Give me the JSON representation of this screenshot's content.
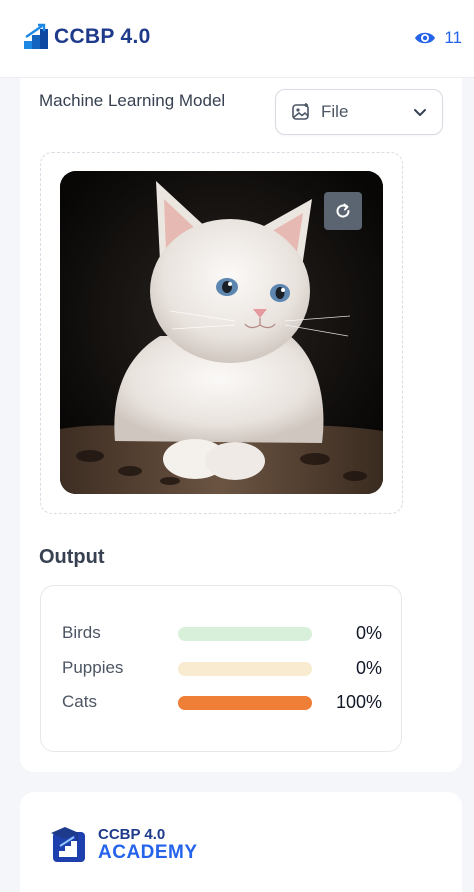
{
  "header": {
    "logo_text": "CCBP 4.0",
    "viewer_count": "11",
    "viewer_icon": "eye-icon"
  },
  "model": {
    "label": "Machine Learning Model",
    "file_button": {
      "label": "File",
      "icon": "image-upload-icon"
    },
    "image": {
      "subject": "white kitten photo",
      "refresh_icon": "refresh-icon"
    }
  },
  "output": {
    "title": "Output",
    "results": [
      {
        "label": "Birds",
        "value_text": "0%",
        "fraction": 0.0,
        "track_color": "#d8f0d9",
        "fill_color": "#8fd19a"
      },
      {
        "label": "Puppies",
        "value_text": "0%",
        "fraction": 0.0,
        "track_color": "#f8ebcf",
        "fill_color": "#f2c66d"
      },
      {
        "label": "Cats",
        "value_text": "100%",
        "fraction": 1.0,
        "track_color": "#f8dcc8",
        "fill_color": "#ef7f36"
      }
    ]
  },
  "footer": {
    "academy_line1": "CCBP 4.0",
    "academy_line2": "ACADEMY"
  }
}
